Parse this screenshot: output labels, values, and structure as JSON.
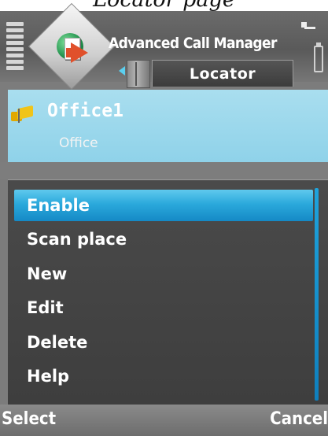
{
  "caption": "Locator page",
  "header": {
    "app_title": "Advanced Call Manager",
    "active_tab": "Locator"
  },
  "place": {
    "name": "Office1",
    "type": "Office"
  },
  "menu": {
    "items": [
      {
        "label": "Enable",
        "selected": true
      },
      {
        "label": "Scan place",
        "selected": false
      },
      {
        "label": "New",
        "selected": false
      },
      {
        "label": "Edit",
        "selected": false
      },
      {
        "label": "Delete",
        "selected": false
      },
      {
        "label": "Help",
        "selected": false
      }
    ]
  },
  "softkeys": {
    "left": "Select",
    "right": "Cancel"
  },
  "colors": {
    "highlight": "#2ba9dc",
    "panel": "#a9deef",
    "menu_bg": "#444444"
  },
  "icons": {
    "app_logo": "advanced-call-manager-logo",
    "place_icon": "location-flag-icon",
    "signal": "signal-strength-icon",
    "battery": "battery-icon",
    "network": "data-connection-icon"
  }
}
